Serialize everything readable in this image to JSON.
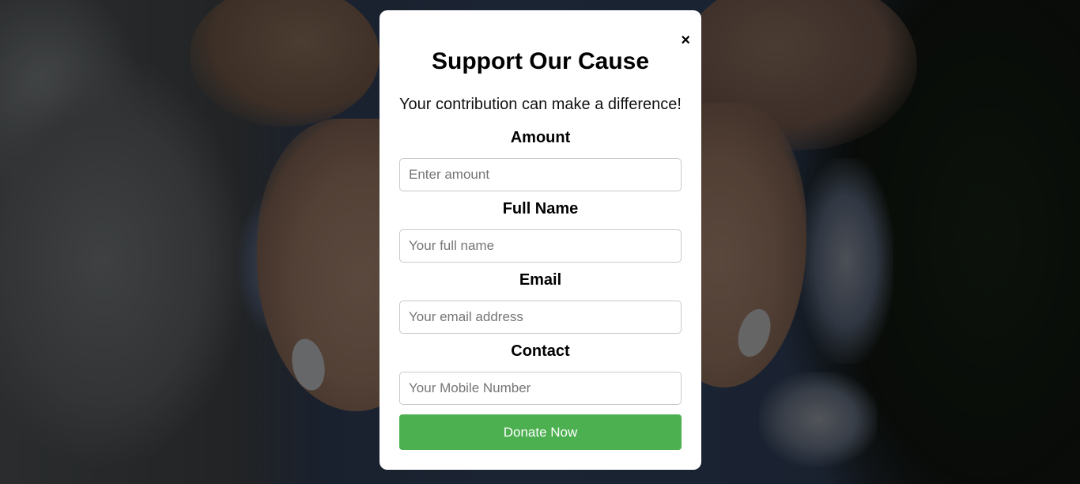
{
  "modal": {
    "close_symbol": "×",
    "title": "Support Our Cause",
    "subtitle": "Your contribution can make a difference!",
    "fields": [
      {
        "label": "Amount",
        "placeholder": "Enter amount",
        "value": ""
      },
      {
        "label": "Full Name",
        "placeholder": "Your full name",
        "value": ""
      },
      {
        "label": "Email",
        "placeholder": "Your email address",
        "value": ""
      },
      {
        "label": "Contact",
        "placeholder": "Your Mobile Number",
        "value": ""
      }
    ],
    "submit_label": "Donate Now"
  },
  "colors": {
    "accent": "#4caf50",
    "overlay": "rgba(0,0,0,0.55)",
    "modal_bg": "#ffffff"
  },
  "icons": {
    "close": "close-icon"
  }
}
